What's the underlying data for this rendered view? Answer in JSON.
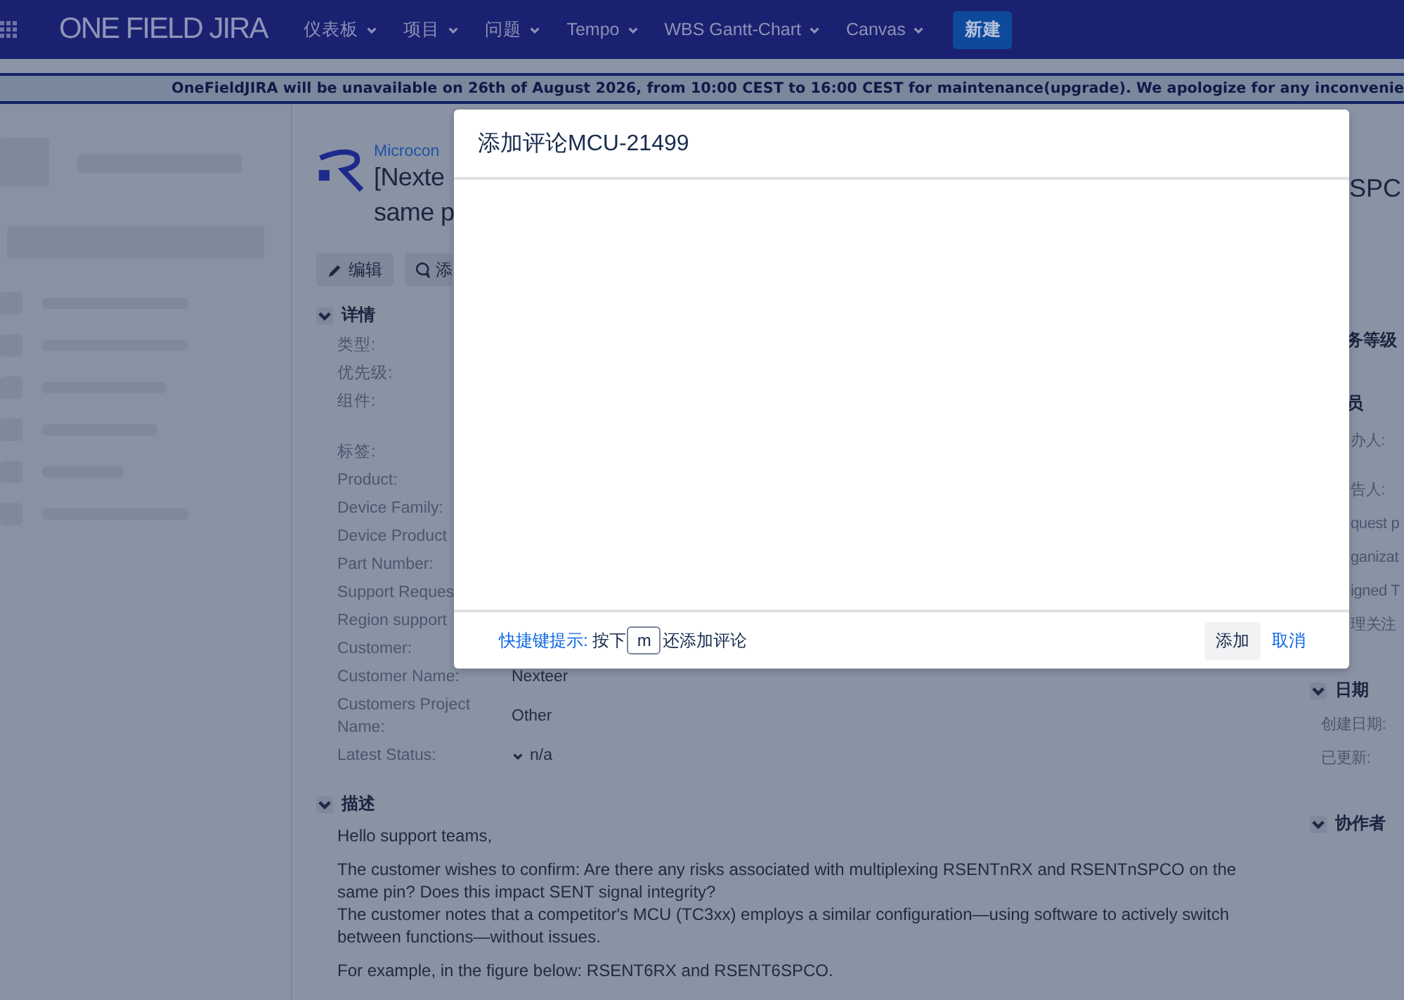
{
  "nav": {
    "logo": "ONE FIELD JIRA",
    "menus": [
      {
        "label": "仪表板"
      },
      {
        "label": "项目"
      },
      {
        "label": "问题"
      },
      {
        "label": "Tempo"
      },
      {
        "label": "WBS Gantt-Chart"
      },
      {
        "label": "Canvas"
      }
    ],
    "create_button": "新建"
  },
  "banner": {
    "text": "OneFieldJIRA will be unavailable on 26th of August 2026, from 10:00 CEST to 16:00 CEST for maintenance(upgrade). We apologize for any inconvenie"
  },
  "issue": {
    "project": "Microcon",
    "title_lines": [
      "[Nexte",
      "same p"
    ],
    "title_right": "SPC",
    "buttons": [
      {
        "kind": "edit",
        "label": "编辑"
      },
      {
        "kind": "comment",
        "label": "添"
      }
    ],
    "details": {
      "heading": "详情",
      "expanded": true,
      "groups": [
        [
          {
            "label": "类型:"
          },
          {
            "label": "优先级:"
          },
          {
            "label": "组件:"
          }
        ],
        [
          {
            "label": "标签:"
          },
          {
            "label": "Product:"
          },
          {
            "label": "Device Family:"
          },
          {
            "label": "Device Product"
          },
          {
            "label": "Part Number:"
          },
          {
            "label": "Support Reques"
          },
          {
            "label": "Region support"
          },
          {
            "label": "Customer:"
          },
          {
            "label": "Customer Name:",
            "value": "Nexteer"
          },
          {
            "label": "Customers Project Name:",
            "value": "Other"
          },
          {
            "label": "Latest Status:",
            "value": "n/a",
            "kind": "dropdown"
          }
        ]
      ]
    },
    "description": {
      "heading": "描述",
      "expanded": true,
      "paragraphs": [
        [
          "Hello support teams,"
        ],
        [
          "The customer wishes to confirm: Are there any risks associated with multiplexing RSENTnRX and RSENTnSPCO on the same pin? Does this impact SENT signal integrity?",
          "The customer notes that a competitor's MCU (TC3xx) employs a similar configuration—using software to actively switch between functions—without issues."
        ],
        [
          "For example, in the figure below: RSENT6RX and RSENT6SPCO."
        ]
      ]
    }
  },
  "side": {
    "sla_heading": "务等级",
    "people": {
      "heading": "员",
      "fields": [
        "办人:",
        "告人:",
        "quest p",
        "ganizat",
        "igned T",
        "理关注"
      ]
    },
    "dates": {
      "heading": "日期",
      "expanded": true,
      "fields": [
        "创建日期:",
        "已更新:"
      ]
    },
    "collaborators": {
      "heading": "协作者",
      "expanded": true
    }
  },
  "modal": {
    "title": "添加评论MCU-21499",
    "hint": {
      "link": "快捷键提示:",
      "before": "按下",
      "key": "m",
      "after": "还添加评论"
    },
    "buttons": [
      {
        "kind": "primary",
        "label": "添加"
      },
      {
        "kind": "link",
        "label": "取消"
      }
    ]
  }
}
